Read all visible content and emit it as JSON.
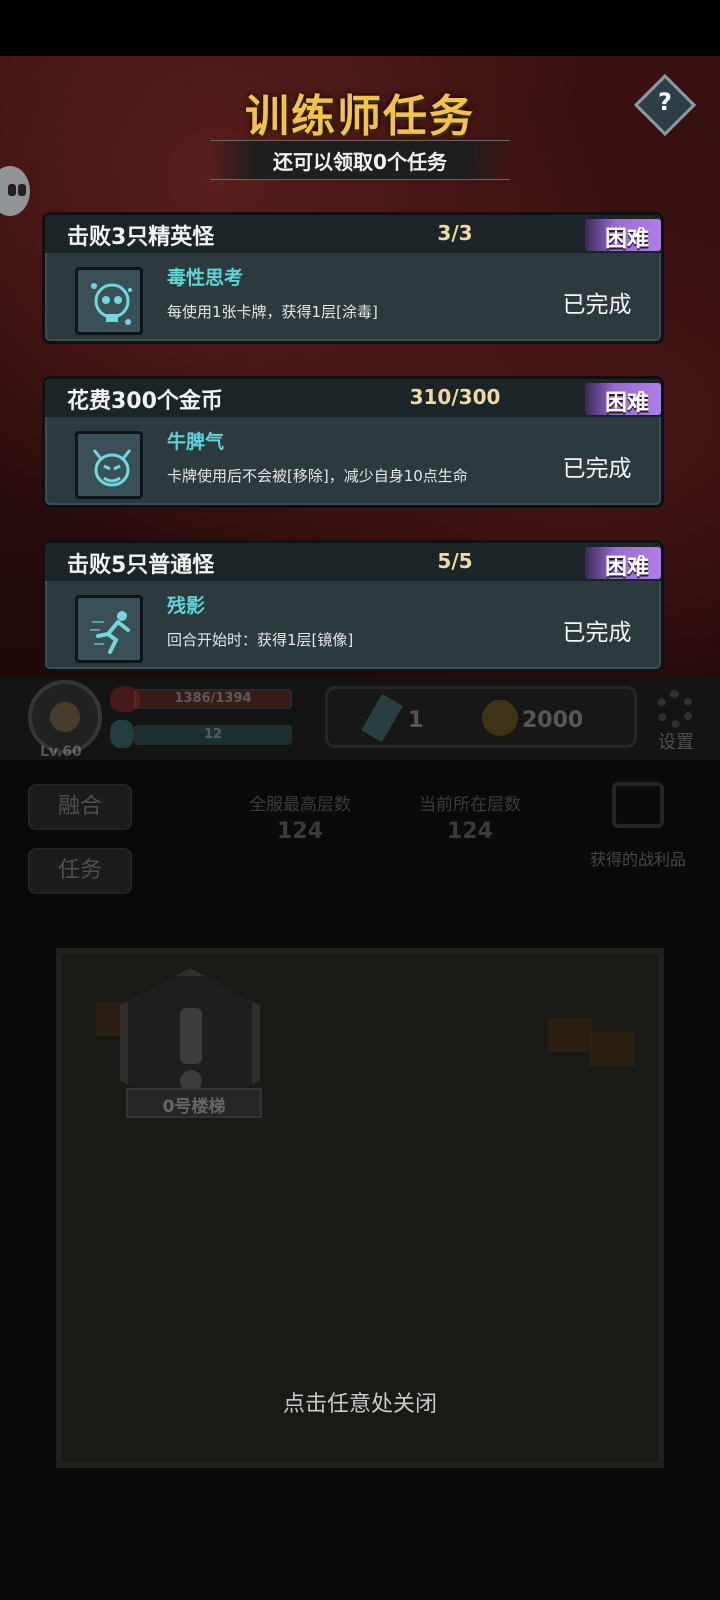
{
  "dialog": {
    "title": "训练师任务",
    "subtitle": "还可以领取0个任务",
    "help_label": "?",
    "close_hint": "点击任意处关闭"
  },
  "tasks": [
    {
      "name": "击败3只精英怪",
      "progress": "3/3",
      "difficulty": "困难",
      "reward_name": "毒性思考",
      "reward_desc": "每使用1张卡牌，获得1层[涂毒]",
      "reward_icon": "poison-skull-icon",
      "status": "已完成"
    },
    {
      "name": "花费300个金币",
      "progress": "310/300",
      "difficulty": "困难",
      "reward_name": "牛脾气",
      "reward_desc": "卡牌使用后不会被[移除]，减少自身10点生命",
      "reward_icon": "demon-face-icon",
      "status": "已完成"
    },
    {
      "name": "击败5只普通怪",
      "progress": "5/5",
      "difficulty": "困难",
      "reward_name": "残影",
      "reward_desc": "回合开始时：获得1层[镜像]",
      "reward_icon": "running-figure-icon",
      "status": "已完成"
    }
  ],
  "hud": {
    "level": "Lv.60",
    "hp": "1386/1394",
    "mp": "12",
    "gems": "1",
    "gold": "2000",
    "settings_label": "设置",
    "fuse_label": "融合",
    "quest_label": "任务",
    "server_top_floor_label": "全服最高层数",
    "server_top_floor": "124",
    "current_floor_label": "当前所在层数",
    "current_floor": "124",
    "loot_label": "获得的战利品",
    "stair_label": "0号楼梯"
  },
  "colors": {
    "title": "#f3c24a",
    "card_bg": "#2d3a3d",
    "reward_name": "#5fd3d6",
    "difficulty": "#9a6ad6"
  }
}
